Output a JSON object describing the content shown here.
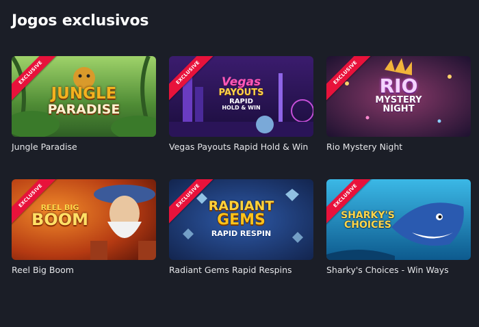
{
  "section": {
    "title": "Jogos exclusivos"
  },
  "ribbon_label": "EXCLUSIVE",
  "games": [
    {
      "name": "Jungle Paradise",
      "logo_lines": [
        "JUNGLE",
        "PARADISE"
      ],
      "accent": "#f0a21a"
    },
    {
      "name": "Vegas Payouts Rapid Hold & Win",
      "logo_lines": [
        "Vegas",
        "PAYOUTS",
        "RAPID",
        "HOLD & WIN"
      ],
      "accent": "#ff3fb0"
    },
    {
      "name": "Rio Mystery Night",
      "logo_lines": [
        "RIO",
        "MYSTERY",
        "NIGHT"
      ],
      "accent": "#f7c7ff"
    },
    {
      "name": "Reel Big Boom",
      "logo_lines": [
        "REEL BIG",
        "BOOM"
      ],
      "accent": "#ffd24a"
    },
    {
      "name": "Radiant Gems Rapid Respins",
      "logo_lines": [
        "RADIANT",
        "GEMS",
        "RAPID RESPIN"
      ],
      "accent": "#ffcf3a"
    },
    {
      "name": "Sharky's Choices - Win Ways",
      "logo_lines": [
        "SHARKY'S",
        "CHOICES"
      ],
      "accent": "#ffd64a"
    }
  ]
}
